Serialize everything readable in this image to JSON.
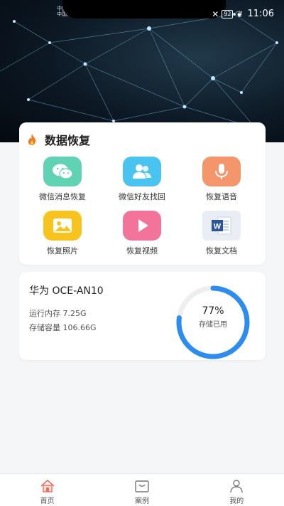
{
  "status": {
    "carrier_line1": "中国移动",
    "carrier_line2": "中国移动",
    "battery": "92",
    "time": "11:06"
  },
  "recovery": {
    "title": "数据恢复",
    "title_icon": "fire-icon",
    "tiles": [
      {
        "label": "微信消息恢复",
        "icon": "wechat-icon",
        "color": "#5fd3b4"
      },
      {
        "label": "微信好友找回",
        "icon": "contacts-icon",
        "color": "#49c4f0"
      },
      {
        "label": "恢复语音",
        "icon": "microphone-icon",
        "color": "#f5956b"
      },
      {
        "label": "恢复照片",
        "icon": "photo-icon",
        "color": "#f7c31c"
      },
      {
        "label": "恢复视频",
        "icon": "play-icon",
        "color": "#f4739a"
      },
      {
        "label": "恢复文档",
        "icon": "word-document-icon",
        "color": "#2b579a"
      }
    ]
  },
  "device": {
    "name": "华为 OCE-AN10",
    "memory": "运行内存 7.25G",
    "storage": "存储容量 106.66G",
    "usage_percent_text": "77%",
    "usage_label": "存储已用",
    "usage_fraction": 0.77,
    "ring_color": "#2d8cf0",
    "ring_track_color": "#eeeeee"
  },
  "tabs": [
    {
      "label": "首页",
      "icon": "home-icon",
      "active": true
    },
    {
      "label": "案例",
      "icon": "case-icon",
      "active": false
    },
    {
      "label": "我的",
      "icon": "user-icon",
      "active": false
    }
  ]
}
